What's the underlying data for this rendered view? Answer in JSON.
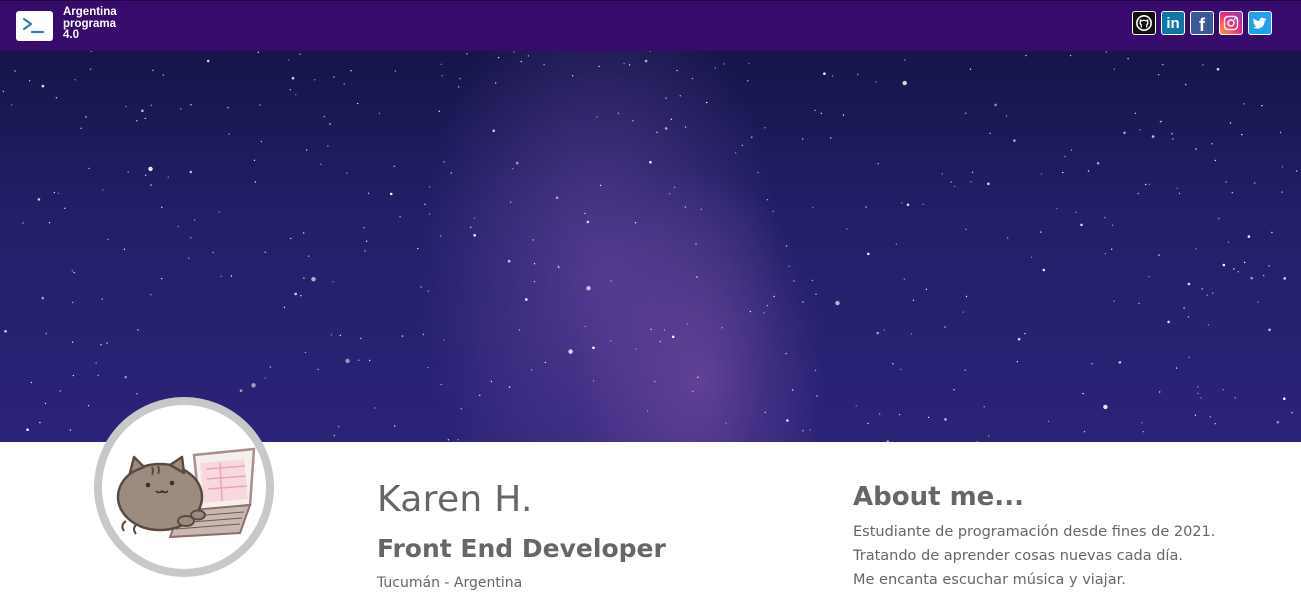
{
  "navbar": {
    "brand_text": "Argentina programa 4.0",
    "brand_icon": "terminal-prompt-icon",
    "social_links": [
      {
        "name": "github",
        "icon": "github-icon",
        "color": "#111111"
      },
      {
        "name": "linkedin",
        "icon": "linkedin-icon",
        "color": "#0e76a8"
      },
      {
        "name": "facebook",
        "icon": "facebook-icon",
        "color": "#3b5998"
      },
      {
        "name": "instagram",
        "icon": "instagram-icon",
        "color": "#ee2a7b"
      },
      {
        "name": "twitter",
        "icon": "twitter-icon",
        "color": "#1da1f2"
      }
    ],
    "background_color": "#370b6b"
  },
  "banner": {
    "image": "starry-night-milky-way"
  },
  "profile": {
    "avatar": "cat-with-laptop",
    "name": "Karen H.",
    "role": "Front End Developer",
    "location": "Tucumán - Argentina"
  },
  "about": {
    "title": "About me...",
    "lines": [
      "Estudiante de programación desde fines de 2021.",
      "Tratando de aprender cosas nuevas cada día.",
      "Me encanta escuchar música y viajar."
    ]
  }
}
